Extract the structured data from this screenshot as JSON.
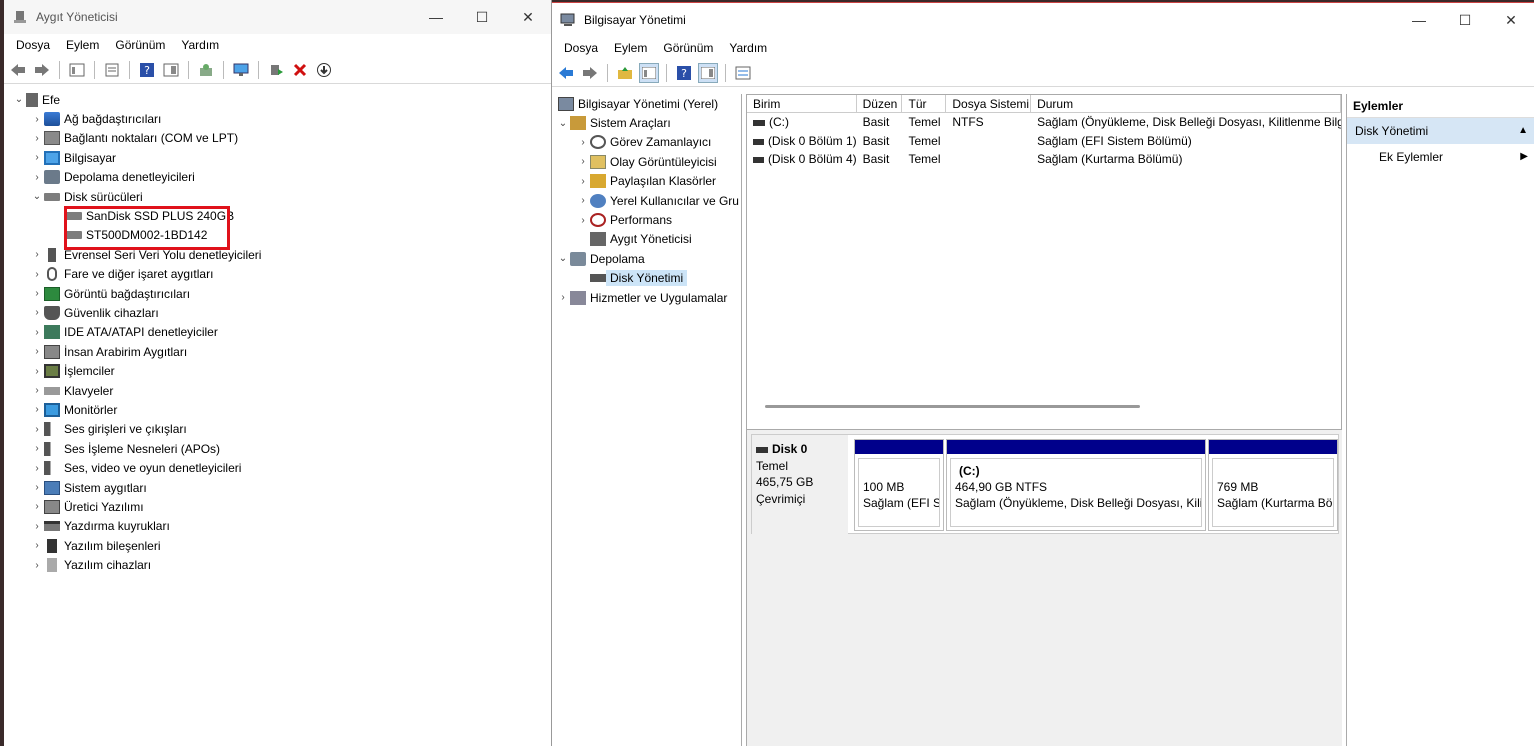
{
  "device_manager": {
    "title": "Aygıt Yöneticisi",
    "window_controls": {
      "minimize": "—",
      "maximize": "☐",
      "close": "✕"
    },
    "menu": [
      "Dosya",
      "Eylem",
      "Görünüm",
      "Yardım"
    ],
    "tree": {
      "root": "Efe",
      "categories": [
        {
          "label": "Ağ bağdaştırıcıları",
          "icon": "network-adapter-icon",
          "expanded": false
        },
        {
          "label": "Bağlantı noktaları (COM ve LPT)",
          "icon": "port-icon",
          "expanded": false
        },
        {
          "label": "Bilgisayar",
          "icon": "computer-icon",
          "expanded": false
        },
        {
          "label": "Depolama denetleyicileri",
          "icon": "storage-controller-icon",
          "expanded": false
        },
        {
          "label": "Disk sürücüleri",
          "icon": "disk-drive-icon",
          "expanded": true,
          "children": [
            "SanDisk SSD PLUS 240GB",
            "ST500DM002-1BD142"
          ]
        },
        {
          "label": "Evrensel Seri Veri Yolu denetleyicileri",
          "icon": "usb-icon",
          "expanded": false
        },
        {
          "label": "Fare ve diğer işaret aygıtları",
          "icon": "mouse-icon",
          "expanded": false
        },
        {
          "label": "Görüntü bağdaştırıcıları",
          "icon": "display-adapter-icon",
          "expanded": false
        },
        {
          "label": "Güvenlik cihazları",
          "icon": "security-device-icon",
          "expanded": false
        },
        {
          "label": "IDE ATA/ATAPI denetleyiciler",
          "icon": "ide-icon",
          "expanded": false
        },
        {
          "label": "İnsan Arabirim Aygıtları",
          "icon": "hid-icon",
          "expanded": false
        },
        {
          "label": "İşlemciler",
          "icon": "processor-icon",
          "expanded": false
        },
        {
          "label": "Klavyeler",
          "icon": "keyboard-icon",
          "expanded": false
        },
        {
          "label": "Monitörler",
          "icon": "monitor-icon",
          "expanded": false
        },
        {
          "label": "Ses girişleri ve çıkışları",
          "icon": "audio-io-icon",
          "expanded": false
        },
        {
          "label": "Ses İşleme Nesneleri (APOs)",
          "icon": "audio-apo-icon",
          "expanded": false
        },
        {
          "label": "Ses, video ve oyun denetleyicileri",
          "icon": "sound-video-icon",
          "expanded": false
        },
        {
          "label": "Sistem aygıtları",
          "icon": "system-device-icon",
          "expanded": false
        },
        {
          "label": "Üretici Yazılımı",
          "icon": "firmware-icon",
          "expanded": false
        },
        {
          "label": "Yazdırma kuyrukları",
          "icon": "print-queue-icon",
          "expanded": false
        },
        {
          "label": "Yazılım bileşenleri",
          "icon": "software-component-icon",
          "expanded": false
        },
        {
          "label": "Yazılım cihazları",
          "icon": "software-device-icon",
          "expanded": false
        }
      ]
    },
    "highlight_color": "#e0121b"
  },
  "computer_management": {
    "title": "Bilgisayar Yönetimi",
    "window_controls": {
      "minimize": "—",
      "maximize": "☐",
      "close": "✕"
    },
    "menu": [
      "Dosya",
      "Eylem",
      "Görünüm",
      "Yardım"
    ],
    "nav": {
      "root": "Bilgisayar Yönetimi (Yerel)",
      "system_tools": "Sistem Araçları",
      "task_scheduler": "Görev Zamanlayıcı",
      "event_viewer": "Olay Görüntüleyicisi",
      "shared_folders": "Paylaşılan Klasörler",
      "local_users": "Yerel Kullanıcılar ve Gru",
      "performance": "Performans",
      "device_manager": "Aygıt Yöneticisi",
      "storage": "Depolama",
      "disk_management": "Disk Yönetimi",
      "services": "Hizmetler ve Uygulamalar"
    },
    "volume_list": {
      "columns": [
        "Birim",
        "Düzen",
        "Tür",
        "Dosya Sistemi",
        "Durum"
      ],
      "rows": [
        {
          "volume": "(C:)",
          "layout": "Basit",
          "type": "Temel",
          "fs": "NTFS",
          "status": "Sağlam (Önyükleme, Disk Belleği Dosyası, Kilitlenme Bilgis"
        },
        {
          "volume": "(Disk 0 Bölüm 1)",
          "layout": "Basit",
          "type": "Temel",
          "fs": "",
          "status": "Sağlam (EFI Sistem Bölümü)"
        },
        {
          "volume": "(Disk 0 Bölüm 4)",
          "layout": "Basit",
          "type": "Temel",
          "fs": "",
          "status": "Sağlam (Kurtarma Bölümü)"
        }
      ]
    },
    "disk": {
      "name": "Disk 0",
      "type": "Temel",
      "size": "465,75 GB",
      "state": "Çevrimiçi",
      "partitions": [
        {
          "name": "",
          "size": "100 MB",
          "status": "Sağlam (EFI Sis"
        },
        {
          "name": "(C:)",
          "size": "464,90 GB NTFS",
          "status": "Sağlam (Önyükleme, Disk Belleği Dosyası, Kilitl"
        },
        {
          "name": "",
          "size": "769 MB",
          "status": "Sağlam (Kurtarma Bölü"
        }
      ],
      "partition_color": "#00008b"
    },
    "actions": {
      "header": "Eylemler",
      "section": "Disk Yönetimi",
      "more": "Ek Eylemler"
    }
  }
}
